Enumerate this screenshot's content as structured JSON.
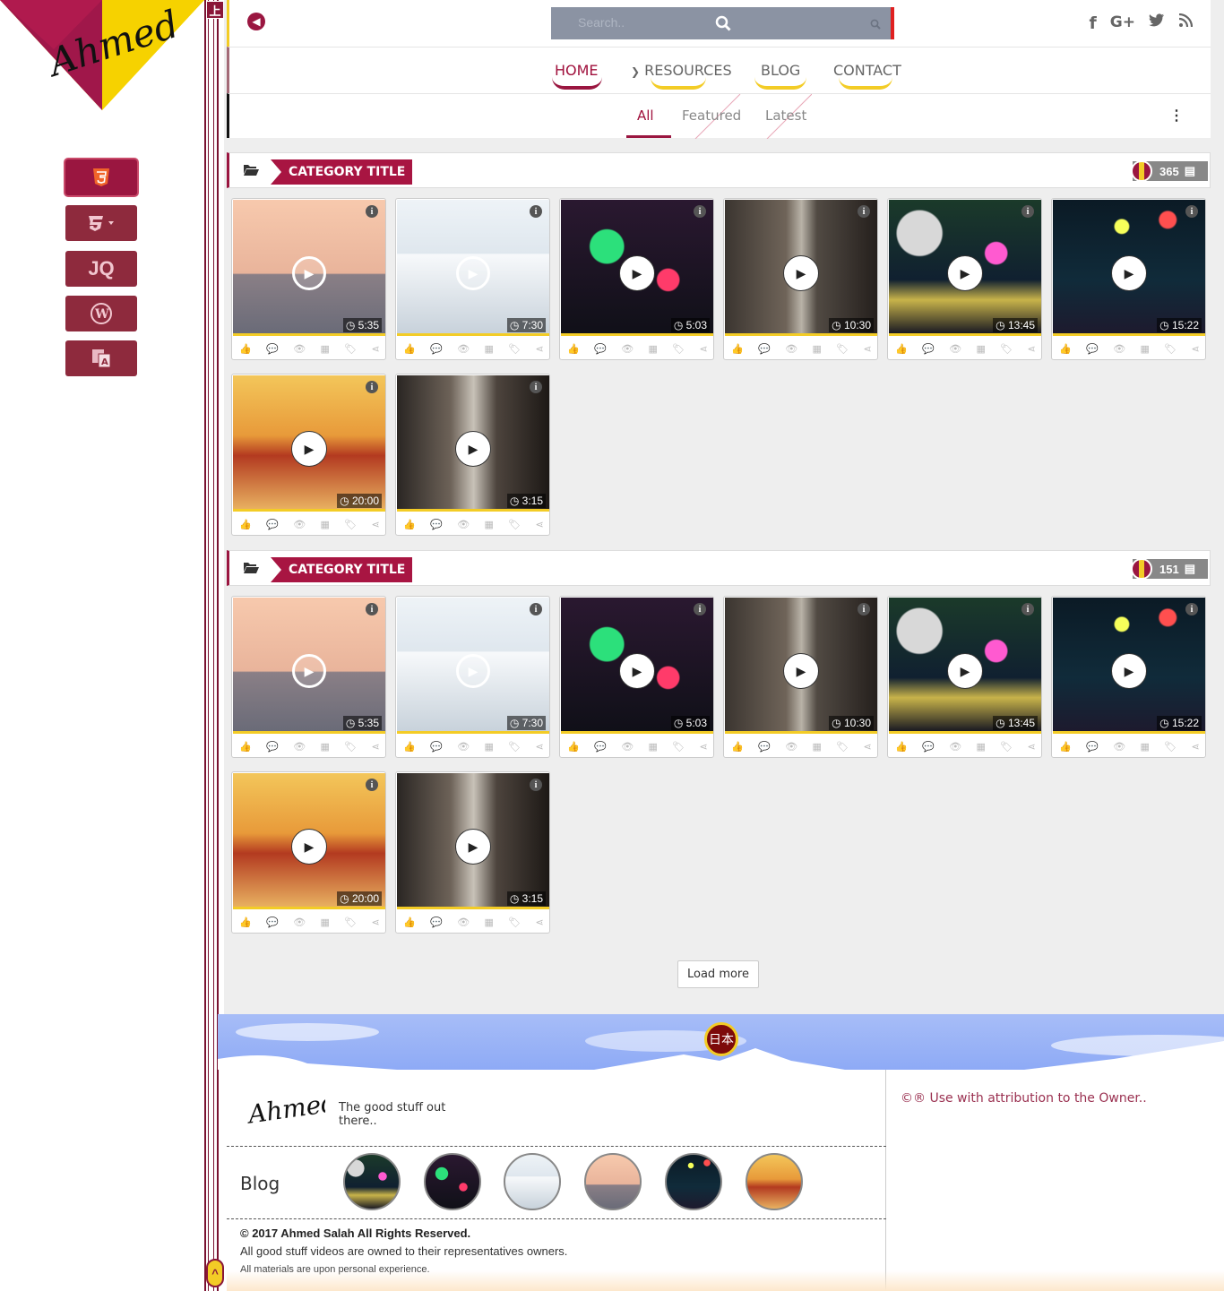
{
  "brand": {
    "logo_text": "Ahmed",
    "colors": {
      "primary": "#9a1640",
      "accent": "#f3cc26"
    }
  },
  "sidebar": {
    "items": [
      {
        "name": "html5",
        "icon": "html5-icon",
        "label": ""
      },
      {
        "name": "css3",
        "icon": "css3-icon",
        "label": ""
      },
      {
        "name": "jquery",
        "icon": "jquery-icon",
        "label": "JQ"
      },
      {
        "name": "wordpress",
        "icon": "wordpress-icon",
        "label": ""
      },
      {
        "name": "translate",
        "icon": "translate-icon",
        "label": ""
      }
    ]
  },
  "rail": {
    "top_label": "上",
    "bottom_label": "^"
  },
  "header": {
    "search_placeholder": "Search..",
    "socials": [
      "facebook-icon",
      "google-plus-icon",
      "twitter-icon",
      "rss-icon"
    ],
    "social_glyphs": [
      "f",
      "G+",
      "t",
      ")))"
    ]
  },
  "nav": {
    "items": [
      {
        "label": "HOME",
        "active": true
      },
      {
        "label": "RESOURCES",
        "active": false,
        "dropdown": true
      },
      {
        "label": "BLOG",
        "active": false
      },
      {
        "label": "CONTACT",
        "active": false
      }
    ]
  },
  "tabs": {
    "items": [
      "All",
      "Featured",
      "Latest"
    ],
    "active": 0
  },
  "categories": [
    {
      "title": "CATEGORY TITLE",
      "count": "365",
      "videos": [
        {
          "duration": "5:35",
          "theme": "skyline"
        },
        {
          "duration": "7:30",
          "theme": "snow"
        },
        {
          "duration": "5:03",
          "theme": "neon-sign"
        },
        {
          "duration": "10:30",
          "theme": "alley"
        },
        {
          "duration": "13:45",
          "theme": "city-night"
        },
        {
          "duration": "15:22",
          "theme": "lanterns"
        },
        {
          "duration": "20:00",
          "theme": "festival"
        },
        {
          "duration": "3:15",
          "theme": "alley2"
        }
      ]
    },
    {
      "title": "CATEGORY TITLE",
      "count": "151",
      "videos": [
        {
          "duration": "5:35",
          "theme": "skyline"
        },
        {
          "duration": "7:30",
          "theme": "snow"
        },
        {
          "duration": "5:03",
          "theme": "neon-sign"
        },
        {
          "duration": "10:30",
          "theme": "alley"
        },
        {
          "duration": "13:45",
          "theme": "city-night"
        },
        {
          "duration": "15:22",
          "theme": "lanterns"
        },
        {
          "duration": "20:00",
          "theme": "festival"
        },
        {
          "duration": "3:15",
          "theme": "alley2"
        }
      ]
    }
  ],
  "card_actions": [
    "like-icon",
    "comment-icon",
    "views-icon",
    "calendar-icon",
    "tags-icon",
    "share-icon"
  ],
  "load_more": "Load more",
  "footer": {
    "badge": "日本",
    "signature": "Ahmed",
    "tagline": "The good stuff out there..",
    "blog_title": "Blog",
    "blog_thumbs": [
      "city-night",
      "neon-sign",
      "snow",
      "skyline",
      "lanterns",
      "festival"
    ],
    "copyright": "© 2017 Ahmed Salah All Rights Reserved.",
    "owned": "All good stuff videos are owned to their representatives owners.",
    "materials": "All materials are upon personal experience.",
    "attribution": "©® Use with attribution to the Owner.."
  }
}
